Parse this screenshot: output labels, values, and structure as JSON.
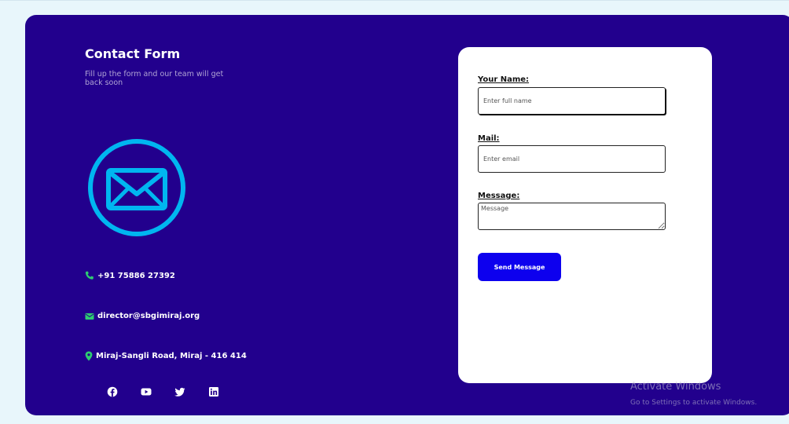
{
  "header": {
    "title": "Contact Form",
    "subtitle": "Fill up the form and our team will get back soon"
  },
  "contact": {
    "phone": "+91 75886 27392",
    "email": "director@sbgimiraj.org",
    "address": "Miraj-Sangli Road, Miraj - 416 414"
  },
  "socials": [
    "facebook-icon",
    "youtube-icon",
    "twitter-icon",
    "linkedin-icon"
  ],
  "form": {
    "name_label": "Your Name:",
    "name_placeholder": "Enter full name",
    "name_value": "",
    "mail_label": "Mail:",
    "mail_placeholder": "Enter email",
    "mail_value": "",
    "message_label": "Message:",
    "message_placeholder": "Message",
    "message_value": "",
    "send_label": "Send Message"
  },
  "watermark": {
    "line1": "Activate Windows",
    "line2": "Go to Settings to activate Windows."
  },
  "colors": {
    "page_background": "#e8f6fb",
    "panel": "#22008d",
    "accent_icon": "#00b6f0",
    "phone_icon": "#2ecc71",
    "pin_icon": "#2ecc71",
    "button": "#0d00ee"
  }
}
